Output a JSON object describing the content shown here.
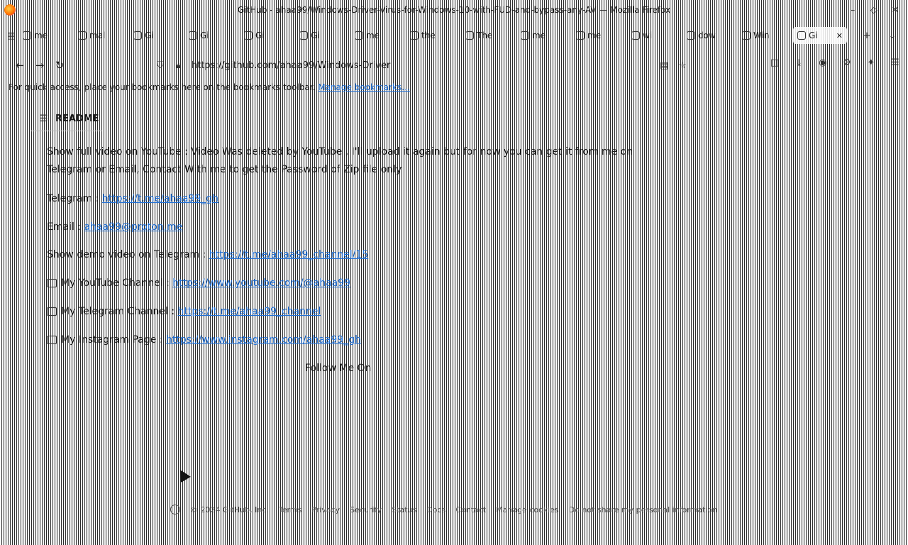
{
  "window": {
    "title": "GitHub - ahaa99/Windows-Driver-Virus-for-Windows-10-with-FUD-and-bypass-any-AV — Mozilla Firefox"
  },
  "tabs": [
    {
      "label": "me"
    },
    {
      "label": "mal"
    },
    {
      "label": "Gi"
    },
    {
      "label": "Gi"
    },
    {
      "label": "Gi"
    },
    {
      "label": "Gi"
    },
    {
      "label": "me"
    },
    {
      "label": "the"
    },
    {
      "label": "The"
    },
    {
      "label": "me"
    },
    {
      "label": "me"
    },
    {
      "label": "wi"
    },
    {
      "label": "dow"
    },
    {
      "label": "Win"
    },
    {
      "label": "Gi",
      "active": true
    }
  ],
  "nav": {
    "url": "https://github.com/ahaa99/Windows-Driver"
  },
  "bookmarks_bar": {
    "text": "For quick access, place your bookmarks here on the bookmarks toolbar.",
    "link": "Manage bookmarks…"
  },
  "readme": {
    "header": "README",
    "intro": "Show full video on YouTube : Video Was deleted by YouTube , I'll upload it again but for now you can get it from me on Telegram or Email, Contact With me to get the Password of Zip file only",
    "telegram_label": "Telegram :",
    "telegram_value": "https://t.me/ahaa99_gh",
    "email_label": "Email :",
    "email_value": "ahaa99@proton.me",
    "demo_label": "Show demo video on Telegram :",
    "demo_value": "https://t.me/ahaa99_channel/15",
    "youtube_label": "My YouTube Channel :",
    "youtube_value": "https://www.youtube.com/@ahaa99",
    "telegram_channel_label": "My Telegram Channel :",
    "telegram_channel_value": "https://t.me/ahaa99_channel",
    "instagram_label": "My Instagram Page :",
    "instagram_value": "https://www.instagram.com/ahaa99_gh",
    "follow": "Follow Me On"
  },
  "footer": {
    "items": [
      "© 2024 GitHub, Inc.",
      "Terms",
      "Privacy",
      "Security",
      "Status",
      "Docs",
      "Contact",
      "Manage cookies",
      "Do not share my personal information"
    ]
  }
}
